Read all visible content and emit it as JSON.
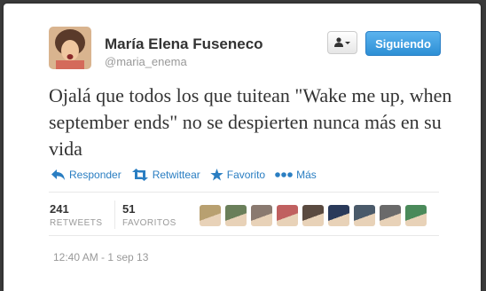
{
  "user": {
    "display_name": "María Elena Fuseneco",
    "handle": "@maria_enema",
    "avatar_icon": "user-avatar"
  },
  "buttons": {
    "user_actions_icon": "person-dropdown-icon",
    "follow_label": "Siguiendo"
  },
  "tweet": {
    "text": "Ojalá que todos los que tuitean \"Wake me up, when september ends\" no se despierten nunca más en su vida"
  },
  "actions": [
    {
      "label": "Responder",
      "icon": "reply-icon"
    },
    {
      "label": "Retwittear",
      "icon": "retweet-icon"
    },
    {
      "label": "Favorito",
      "icon": "star-icon"
    },
    {
      "label": "Más",
      "icon": "more-dots-icon"
    }
  ],
  "stats": {
    "retweets": {
      "count": "241",
      "label": "RETWEETS"
    },
    "favorites": {
      "count": "51",
      "label": "FAVORITOS"
    }
  },
  "favoriters": [
    {
      "color": "#b8a070"
    },
    {
      "color": "#6a7f5a"
    },
    {
      "color": "#8a7a70"
    },
    {
      "color": "#c06060"
    },
    {
      "color": "#5a4a40"
    },
    {
      "color": "#2a3a5a"
    },
    {
      "color": "#4a5a6a"
    },
    {
      "color": "#6a6a6a"
    },
    {
      "color": "#4a8a5a"
    }
  ],
  "timestamp": "12:40 AM - 1 sep 13",
  "colors": {
    "link": "#2a7ec2",
    "follow_button": "#2d8fd5",
    "text": "#333333",
    "muted": "#999999"
  }
}
